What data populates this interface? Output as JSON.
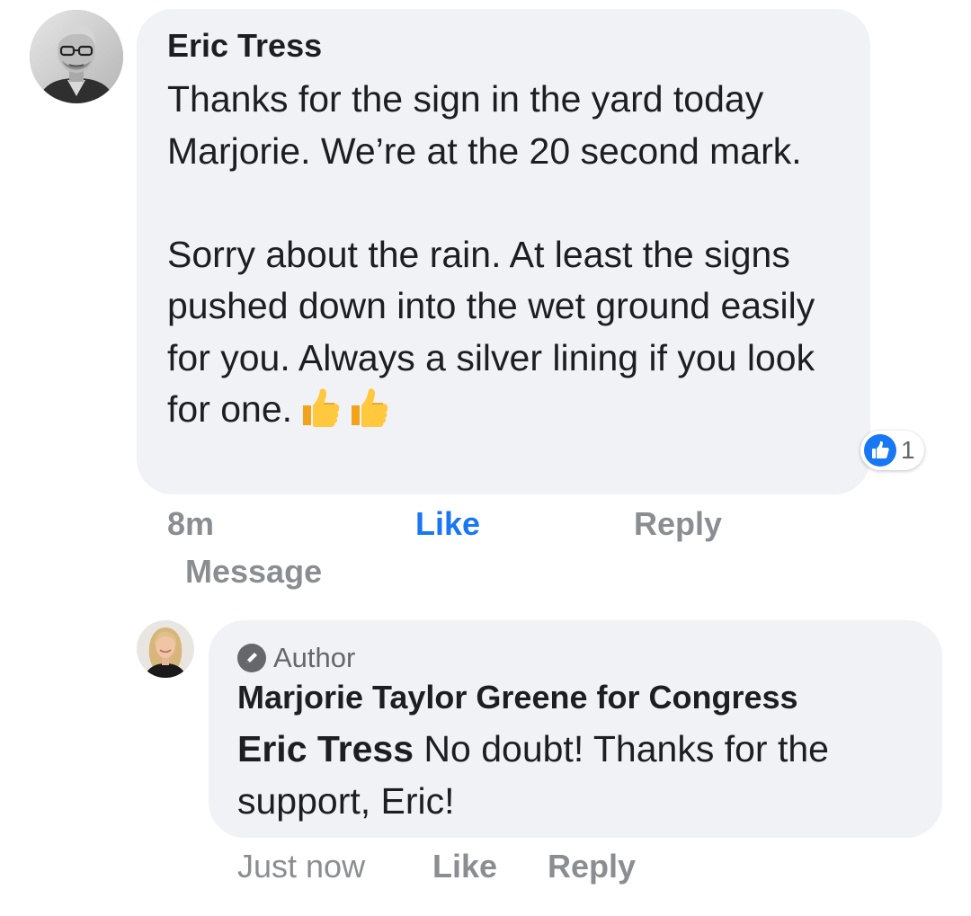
{
  "comment": {
    "author": "Eric Tress",
    "paragraph1": "Thanks for the sign in the yard today Marjorie. We’re at the 20 second mark.",
    "paragraph2": "Sorry about the rain. At least the signs pushed down into the wet ground easily for you. Always a silver lining if you look for one.",
    "emoji": [
      "thumbs-up-icon",
      "thumbs-up-icon"
    ],
    "reaction": {
      "icon": "like-icon",
      "count": "1"
    },
    "actions": {
      "time": "8m",
      "like": "Like",
      "reply": "Reply",
      "message": "Message"
    }
  },
  "reply": {
    "badge": "Author",
    "author": "Marjorie Taylor Greene for Congress",
    "mention": "Eric Tress",
    "text": " No doubt! Thanks for the support, Eric!",
    "actions": {
      "time": "Just now",
      "like": "Like",
      "reply": "Reply"
    }
  },
  "colors": {
    "bubble": "#f0f2f5",
    "text": "#1c1e21",
    "meta": "#8a8d91",
    "accent": "#1877f2"
  }
}
